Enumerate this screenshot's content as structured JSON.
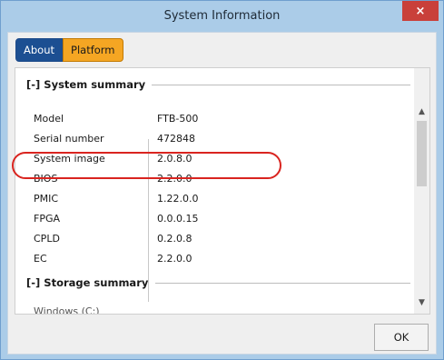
{
  "window": {
    "title": "System Information",
    "close_glyph": "×"
  },
  "tabs": [
    {
      "label": "About"
    },
    {
      "label": "Platform"
    }
  ],
  "system_summary": {
    "header": "[-] System summary",
    "rows": [
      {
        "label": "Model",
        "value": "FTB-500"
      },
      {
        "label": "Serial number",
        "value": "472848"
      },
      {
        "label": "System image",
        "value": "2.0.8.0"
      },
      {
        "label": "BIOS",
        "value": "2.2.0.0"
      },
      {
        "label": "PMIC",
        "value": "1.22.0.0"
      },
      {
        "label": "FPGA",
        "value": "0.0.0.15"
      },
      {
        "label": "CPLD",
        "value": "0.2.0.8"
      },
      {
        "label": "EC",
        "value": "2.2.0.0"
      }
    ]
  },
  "storage_summary": {
    "header": "[-] Storage summary",
    "first_row_label": "Windows (C:)"
  },
  "footer": {
    "ok_label": "OK"
  },
  "colors": {
    "tab_active": "#f5a623",
    "tab_inactive": "#1c4f92",
    "highlight": "#d9241f",
    "close": "#c9403a"
  }
}
